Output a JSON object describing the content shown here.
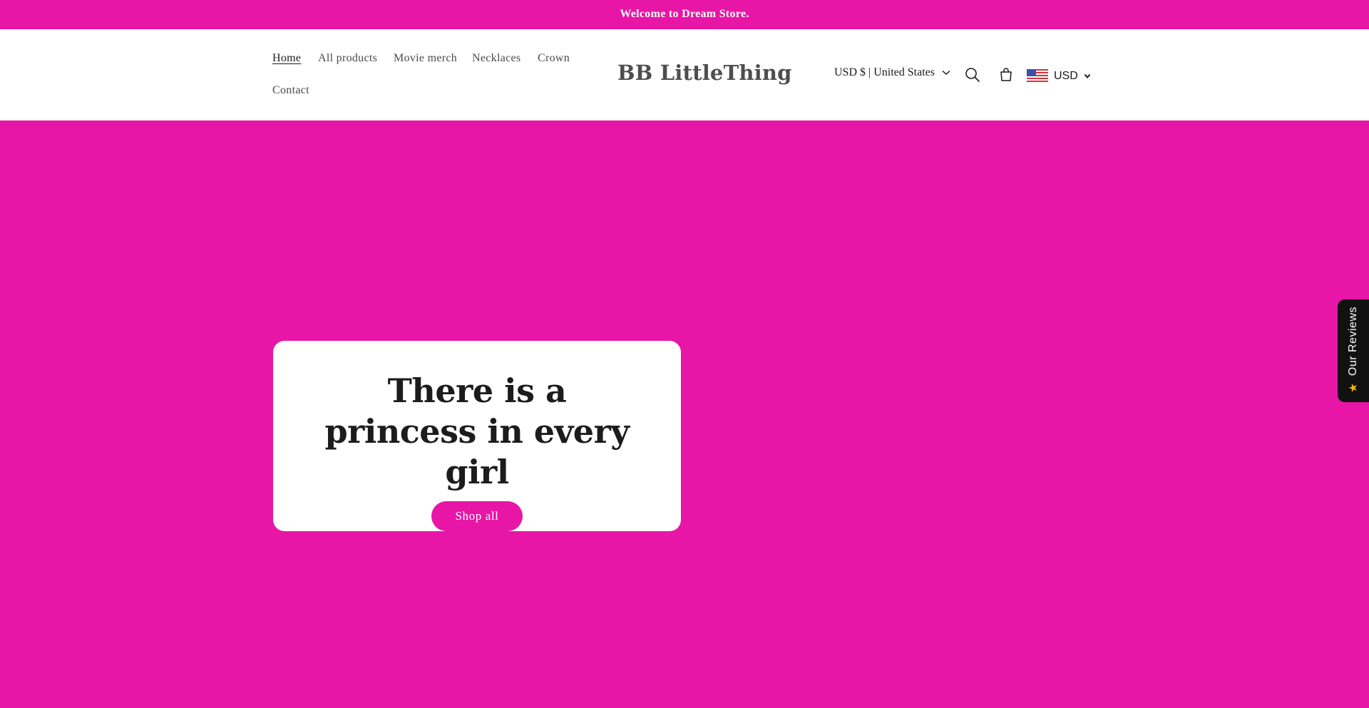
{
  "announcement": {
    "text": "Welcome to Dream Store."
  },
  "nav": {
    "items": [
      {
        "label": "Home",
        "active": true
      },
      {
        "label": "All products"
      },
      {
        "label": "Movie merch"
      },
      {
        "label": "Necklaces"
      },
      {
        "label": "Crown"
      },
      {
        "label": "Contact"
      }
    ]
  },
  "header": {
    "logo": "BB LittleThing",
    "country_selector": "USD $ | United States",
    "search_icon": "search-icon",
    "cart_icon": "cart-icon"
  },
  "currency": {
    "flag_icon": "us-flag-icon",
    "code": "USD"
  },
  "hero": {
    "title": "There is a princess in every girl",
    "button": "Shop all"
  },
  "reviews_tab": {
    "label": "Our Reviews",
    "icon": "star-icon"
  },
  "colors": {
    "brand": "#e716a6",
    "text": "#1c1c1c",
    "card": "#ffffff",
    "reviews_tab": "#111111",
    "star": "#f5b400"
  }
}
